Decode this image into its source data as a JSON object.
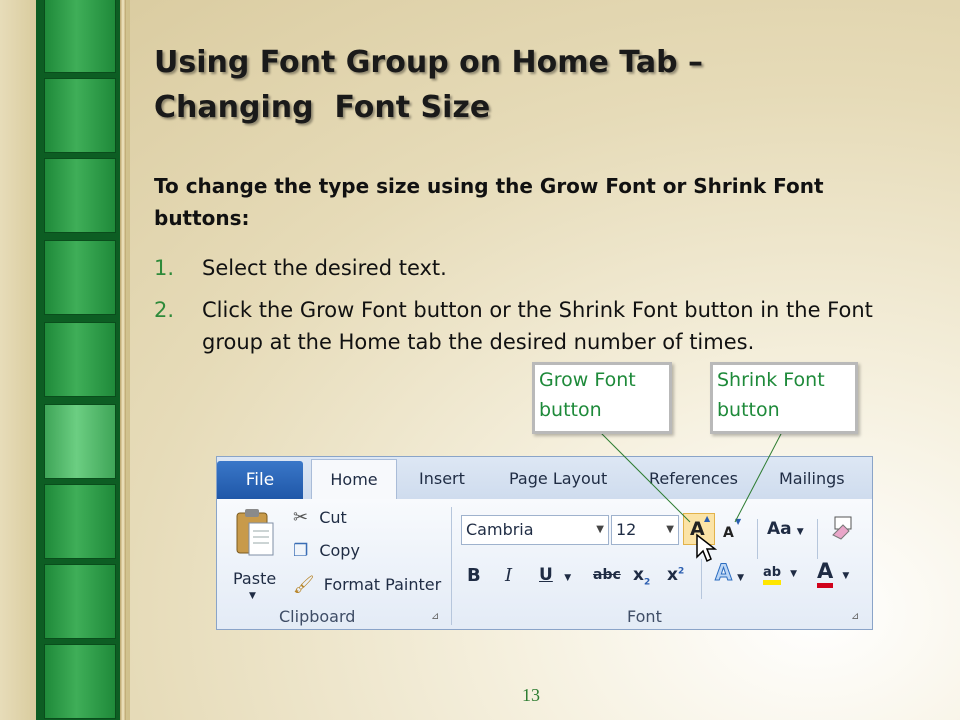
{
  "slide": {
    "title_line1": "Using Font Group on Home Tab –",
    "title_line2": "Changing  Font Size",
    "intro": "To change the type size using the Grow Font or Shrink Font buttons:",
    "steps": [
      {
        "num": "1.",
        "text": "Select the desired text."
      },
      {
        "num": "2.",
        "text": "Click the Grow Font button or the Shrink Font button in the Font group at the Home tab the desired number of times."
      }
    ],
    "callouts": {
      "grow": "Grow Font button",
      "shrink": "Shrink Font button"
    },
    "page_number": "13"
  },
  "ribbon": {
    "tabs": [
      "File",
      "Home",
      "Insert",
      "Page Layout",
      "References",
      "Mailings"
    ],
    "clipboard": {
      "paste": "Paste",
      "cut": "Cut",
      "copy": "Copy",
      "format_painter": "Format Painter",
      "label": "Clipboard"
    },
    "font": {
      "name": "Cambria",
      "size": "12",
      "label": "Font"
    }
  },
  "colors": {
    "accent_green": "#2e8a3a",
    "ribbon_blue": "#1f57a8",
    "font_color_red": "#d0021b",
    "highlight_yellow": "#ffe600"
  }
}
